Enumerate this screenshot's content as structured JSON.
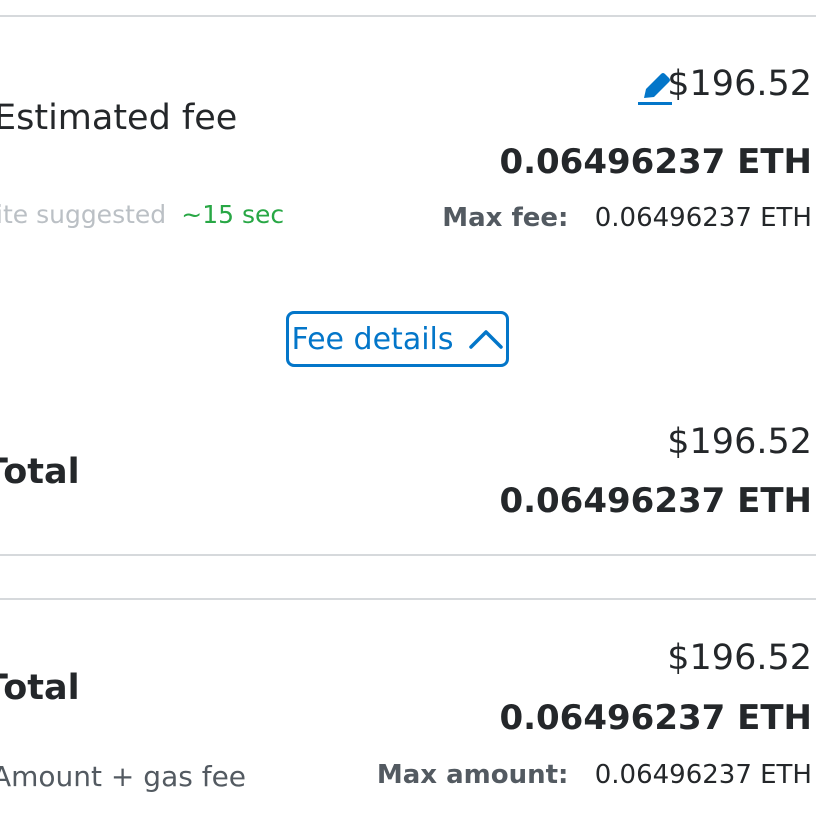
{
  "estimated_fee": {
    "label": "Estimated fee",
    "source": "ite suggested",
    "time": "~15 sec",
    "fiat": "$196.52",
    "eth": "0.06496237 ETH",
    "max_label": "Max fee:",
    "max_value": "0.06496237 ETH",
    "edit_icon": "edit-pencil-icon"
  },
  "fee_details_button": {
    "label": "Fee details",
    "icon": "chevron-up-icon"
  },
  "total_first": {
    "label": "Total",
    "fiat": "$196.52",
    "eth": "0.06496237 ETH"
  },
  "total_second": {
    "label": "Total",
    "fiat": "$196.52",
    "eth": "0.06496237 ETH",
    "subtext": "Amount + gas fee",
    "max_label": "Max amount:",
    "max_value": "0.06496237 ETH"
  },
  "colors": {
    "accent": "#0376c9",
    "success": "#28a745",
    "muted": "#bbc0c5",
    "text": "#24272a",
    "divider": "#d6d9dc"
  }
}
